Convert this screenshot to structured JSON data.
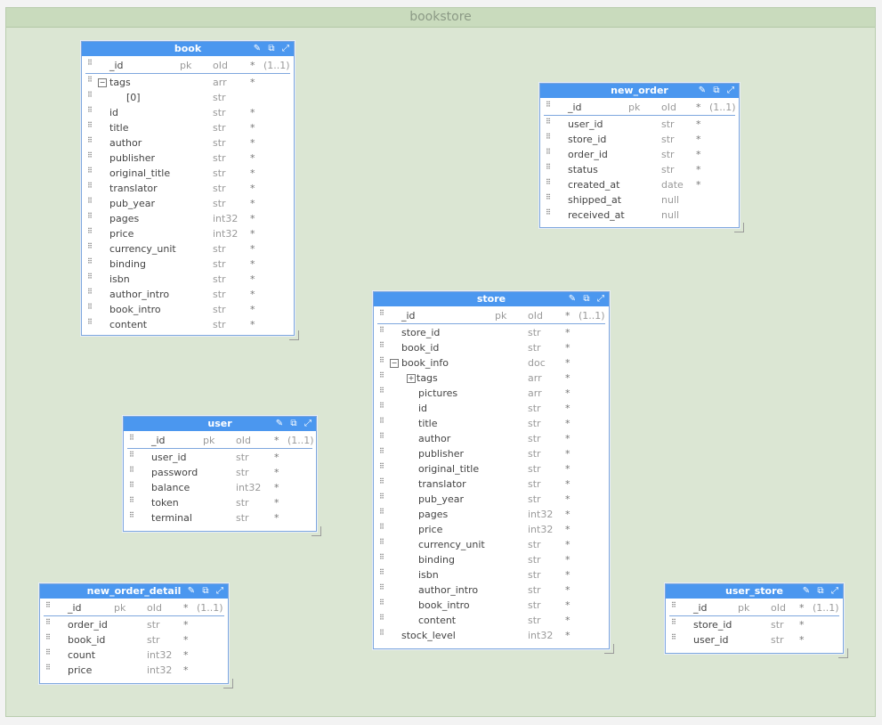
{
  "canvas": {
    "title": "bookstore"
  },
  "icons": {
    "pin": "pin-icon",
    "open": "open-external-icon",
    "expand": "expand-icon",
    "grip": "drag-handle-icon"
  },
  "tables": {
    "book": {
      "title": "book",
      "pk": {
        "name": "_id",
        "pk": "pk",
        "type": "oId",
        "req": "*",
        "card": "(1..1)"
      },
      "fields": [
        {
          "name": "tags",
          "type": "arr",
          "req": "*",
          "toggle": "−",
          "level": 0
        },
        {
          "name": "[0]",
          "type": "str",
          "req": "",
          "level": 1
        },
        {
          "name": "id",
          "type": "str",
          "req": "*",
          "level": 0
        },
        {
          "name": "title",
          "type": "str",
          "req": "*",
          "level": 0
        },
        {
          "name": "author",
          "type": "str",
          "req": "*",
          "level": 0
        },
        {
          "name": "publisher",
          "type": "str",
          "req": "*",
          "level": 0
        },
        {
          "name": "original_title",
          "type": "str",
          "req": "*",
          "level": 0
        },
        {
          "name": "translator",
          "type": "str",
          "req": "*",
          "level": 0
        },
        {
          "name": "pub_year",
          "type": "str",
          "req": "*",
          "level": 0
        },
        {
          "name": "pages",
          "type": "int32",
          "req": "*",
          "level": 0
        },
        {
          "name": "price",
          "type": "int32",
          "req": "*",
          "level": 0
        },
        {
          "name": "currency_unit",
          "type": "str",
          "req": "*",
          "level": 0
        },
        {
          "name": "binding",
          "type": "str",
          "req": "*",
          "level": 0
        },
        {
          "name": "isbn",
          "type": "str",
          "req": "*",
          "level": 0
        },
        {
          "name": "author_intro",
          "type": "str",
          "req": "*",
          "level": 0
        },
        {
          "name": "book_intro",
          "type": "str",
          "req": "*",
          "level": 0
        },
        {
          "name": "content",
          "type": "str",
          "req": "*",
          "level": 0
        }
      ]
    },
    "new_order": {
      "title": "new_order",
      "pk": {
        "name": "_id",
        "pk": "pk",
        "type": "oId",
        "req": "*",
        "card": "(1..1)"
      },
      "fields": [
        {
          "name": "user_id",
          "type": "str",
          "req": "*",
          "level": 0
        },
        {
          "name": "store_id",
          "type": "str",
          "req": "*",
          "level": 0
        },
        {
          "name": "order_id",
          "type": "str",
          "req": "*",
          "level": 0
        },
        {
          "name": "status",
          "type": "str",
          "req": "*",
          "level": 0
        },
        {
          "name": "created_at",
          "type": "date",
          "req": "*",
          "level": 0
        },
        {
          "name": "shipped_at",
          "type": "null",
          "req": "",
          "level": 0
        },
        {
          "name": "received_at",
          "type": "null",
          "req": "",
          "level": 0
        }
      ]
    },
    "store": {
      "title": "store",
      "pk": {
        "name": "_id",
        "pk": "pk",
        "type": "oId",
        "req": "*",
        "card": "(1..1)"
      },
      "fields": [
        {
          "name": "store_id",
          "type": "str",
          "req": "*",
          "level": 0
        },
        {
          "name": "book_id",
          "type": "str",
          "req": "*",
          "level": 0
        },
        {
          "name": "book_info",
          "type": "doc",
          "req": "*",
          "toggle": "−",
          "level": 0
        },
        {
          "name": "tags",
          "type": "arr",
          "req": "*",
          "toggle": "+",
          "level": 1
        },
        {
          "name": "pictures",
          "type": "arr",
          "req": "*",
          "level": 1
        },
        {
          "name": "id",
          "type": "str",
          "req": "*",
          "level": 1
        },
        {
          "name": "title",
          "type": "str",
          "req": "*",
          "level": 1
        },
        {
          "name": "author",
          "type": "str",
          "req": "*",
          "level": 1
        },
        {
          "name": "publisher",
          "type": "str",
          "req": "*",
          "level": 1
        },
        {
          "name": "original_title",
          "type": "str",
          "req": "*",
          "level": 1
        },
        {
          "name": "translator",
          "type": "str",
          "req": "*",
          "level": 1
        },
        {
          "name": "pub_year",
          "type": "str",
          "req": "*",
          "level": 1
        },
        {
          "name": "pages",
          "type": "int32",
          "req": "*",
          "level": 1
        },
        {
          "name": "price",
          "type": "int32",
          "req": "*",
          "level": 1
        },
        {
          "name": "currency_unit",
          "type": "str",
          "req": "*",
          "level": 1
        },
        {
          "name": "binding",
          "type": "str",
          "req": "*",
          "level": 1
        },
        {
          "name": "isbn",
          "type": "str",
          "req": "*",
          "level": 1
        },
        {
          "name": "author_intro",
          "type": "str",
          "req": "*",
          "level": 1
        },
        {
          "name": "book_intro",
          "type": "str",
          "req": "*",
          "level": 1
        },
        {
          "name": "content",
          "type": "str",
          "req": "*",
          "level": 1
        },
        {
          "name": "stock_level",
          "type": "int32",
          "req": "*",
          "level": 0
        }
      ]
    },
    "user": {
      "title": "user",
      "pk": {
        "name": "_id",
        "pk": "pk",
        "type": "oId",
        "req": "*",
        "card": "(1..1)"
      },
      "fields": [
        {
          "name": "user_id",
          "type": "str",
          "req": "*",
          "level": 0
        },
        {
          "name": "password",
          "type": "str",
          "req": "*",
          "level": 0
        },
        {
          "name": "balance",
          "type": "int32",
          "req": "*",
          "level": 0
        },
        {
          "name": "token",
          "type": "str",
          "req": "*",
          "level": 0
        },
        {
          "name": "terminal",
          "type": "str",
          "req": "*",
          "level": 0
        }
      ]
    },
    "new_order_detail": {
      "title": "new_order_detail",
      "pk": {
        "name": "_id",
        "pk": "pk",
        "type": "oId",
        "req": "*",
        "card": "(1..1)"
      },
      "fields": [
        {
          "name": "order_id",
          "type": "str",
          "req": "*",
          "level": 0
        },
        {
          "name": "book_id",
          "type": "str",
          "req": "*",
          "level": 0
        },
        {
          "name": "count",
          "type": "int32",
          "req": "*",
          "level": 0
        },
        {
          "name": "price",
          "type": "int32",
          "req": "*",
          "level": 0
        }
      ]
    },
    "user_store": {
      "title": "user_store",
      "pk": {
        "name": "_id",
        "pk": "pk",
        "type": "oId",
        "req": "*",
        "card": "(1..1)"
      },
      "fields": [
        {
          "name": "store_id",
          "type": "str",
          "req": "*",
          "level": 0
        },
        {
          "name": "user_id",
          "type": "str",
          "req": "*",
          "level": 0
        }
      ]
    }
  }
}
